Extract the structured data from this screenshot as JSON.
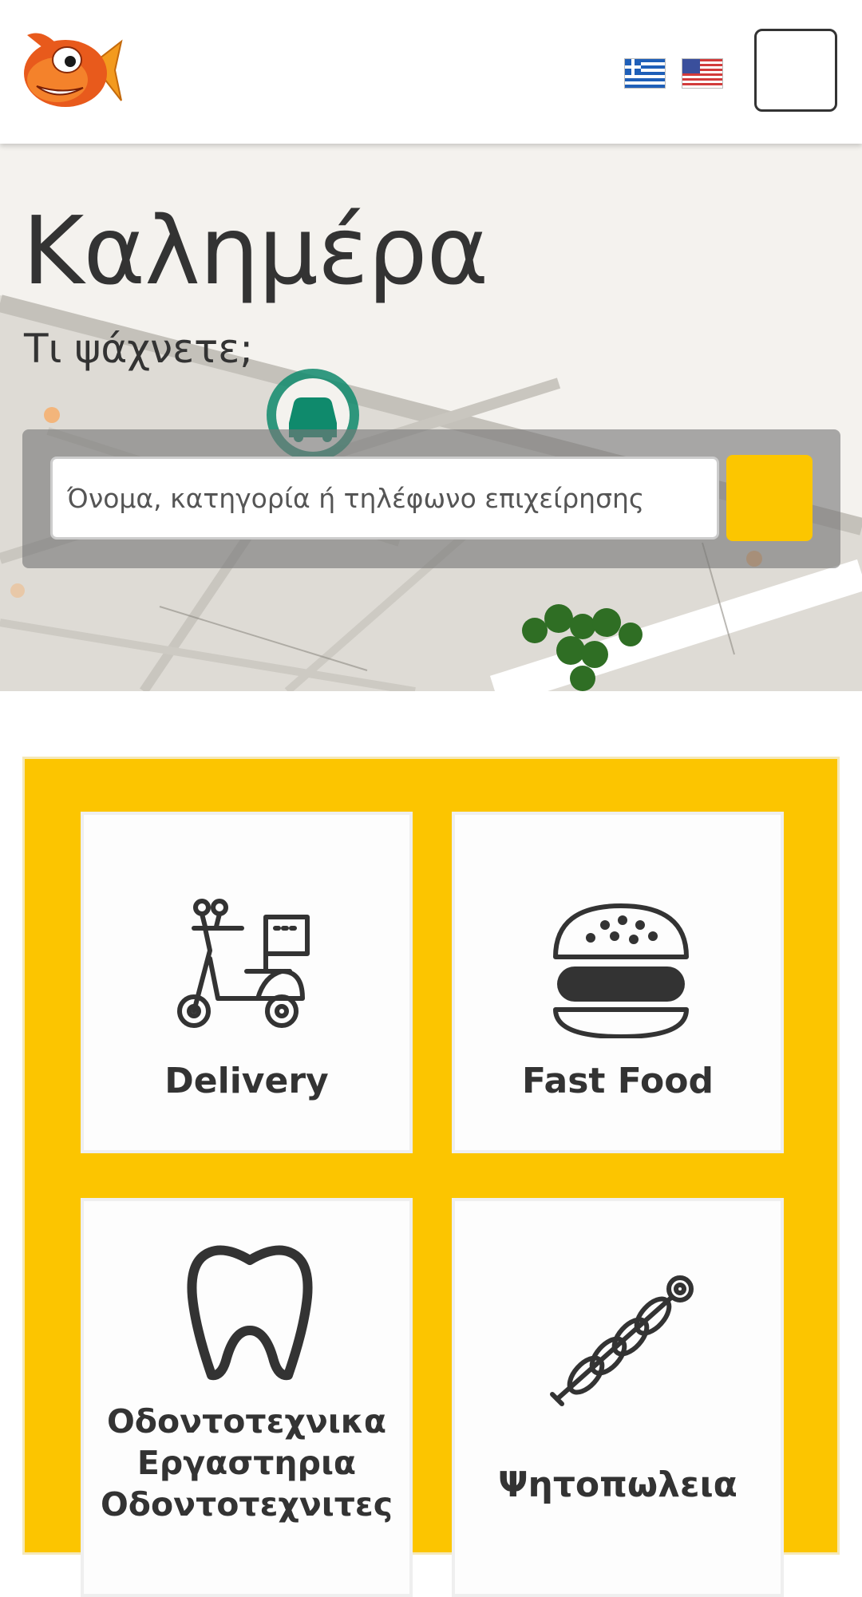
{
  "header": {
    "logo_icon": "fish-logo",
    "languages": [
      {
        "code": "gr",
        "icon": "greek-flag-icon"
      },
      {
        "code": "en",
        "icon": "us-flag-icon"
      }
    ],
    "menu_icon": "hamburger-menu"
  },
  "hero": {
    "title": "Καλημέρα",
    "subtitle": "Τι ψάχνετε;",
    "search": {
      "placeholder": "Όνομα, κατηγορία ή τηλέφωνο επιχείρησης",
      "value": "",
      "button_icon": "search-icon"
    },
    "background_icon": "map-background"
  },
  "categories": [
    {
      "label": "Delivery",
      "icon": "scooter-icon"
    },
    {
      "label": "Fast Food",
      "icon": "burger-icon"
    },
    {
      "label_lines": [
        "Οδοντοτεχνικα",
        "Εργαστηρια",
        "Οδοντοτεχνιτες"
      ],
      "icon": "tooth-icon"
    },
    {
      "label": "Ψητοπωλεια",
      "icon": "skewer-icon"
    }
  ],
  "colors": {
    "accent": "#fcc600",
    "text": "#333333",
    "card_background": "#fdfdfd"
  }
}
